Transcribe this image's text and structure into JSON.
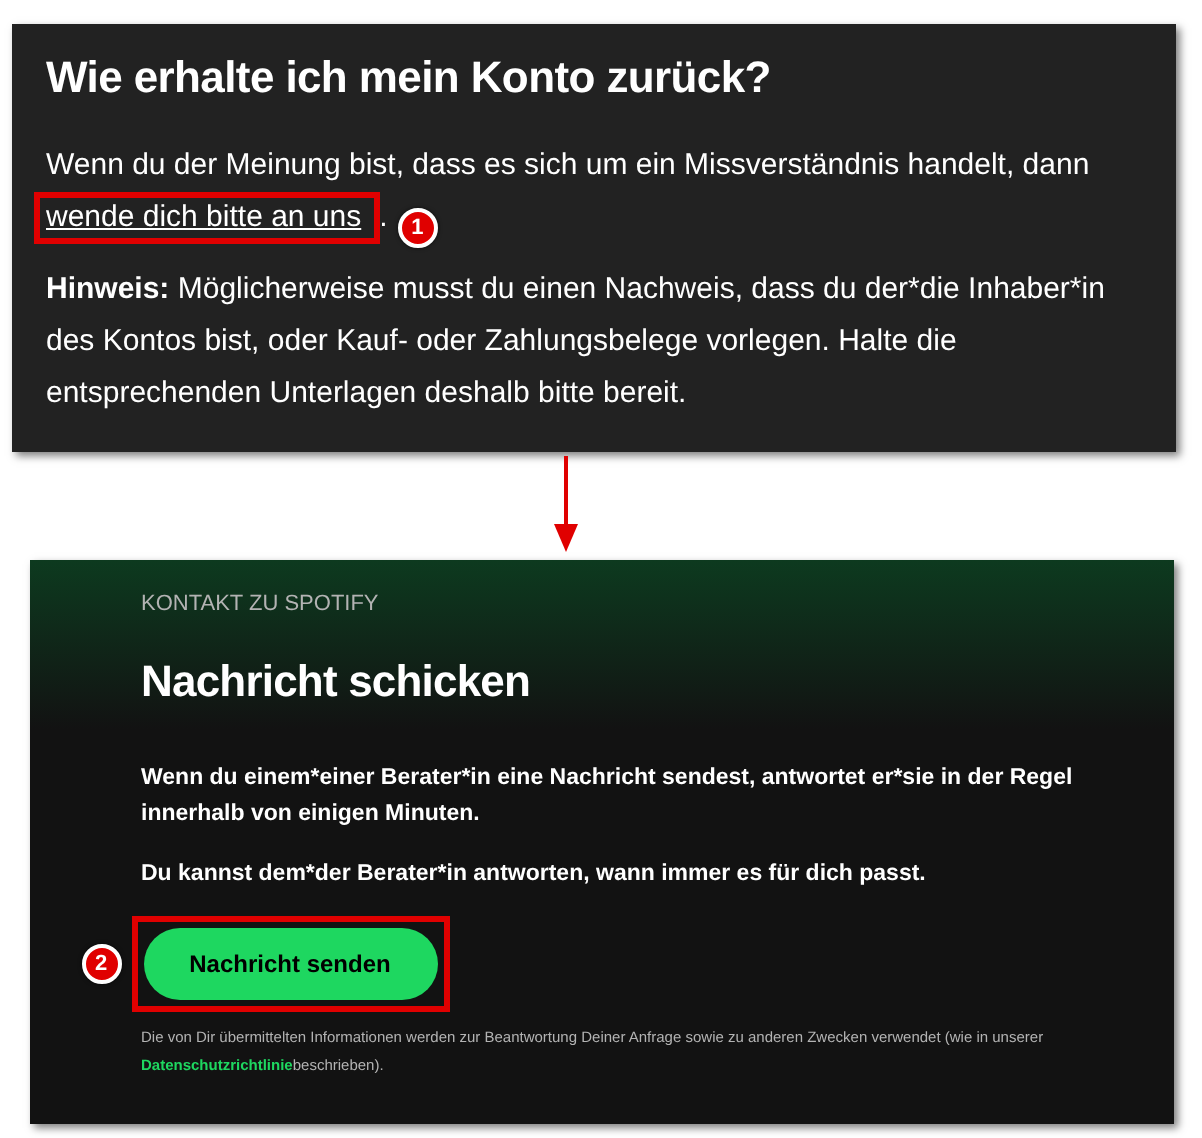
{
  "help_article": {
    "title": "Wie erhalte ich mein Konto zurück?",
    "intro_text": "Wenn du der Meinung bist, dass es sich um ein Missverständnis handelt, dann ",
    "contact_link": "wende dich bitte an uns",
    "intro_end": ".",
    "link_badge": "1",
    "note_label": "Hinweis:",
    "note_text": " Möglicherweise musst du einen Nachweis, dass du der*die Inhaber*in des Kontos bist, oder Kauf- oder Zahlungsbelege vorlegen. Halte die entsprechenden Unterlagen deshalb bitte bereit."
  },
  "contact_page": {
    "eyebrow": "KONTAKT ZU SPOTIFY",
    "title": "Nachricht schicken",
    "paragraphs": [
      "Wenn du einem*einer Berater*in eine Nachricht sendest, antwortet er*sie in der Regel innerhalb von einigen Minuten.",
      "Du kannst dem*der Berater*in antworten, wann immer es für dich passt."
    ],
    "button": "Nachricht senden",
    "button_badge": "2",
    "disclaimer_text": "Die von Dir übermittelten Informationen werden zur Beantwortung Deiner Anfrage sowie zu anderen Zwecken verwendet (wie in unserer ",
    "privacy_link": "Datenschutzrichtlinie",
    "disclaimer_end": "beschrieben)."
  }
}
